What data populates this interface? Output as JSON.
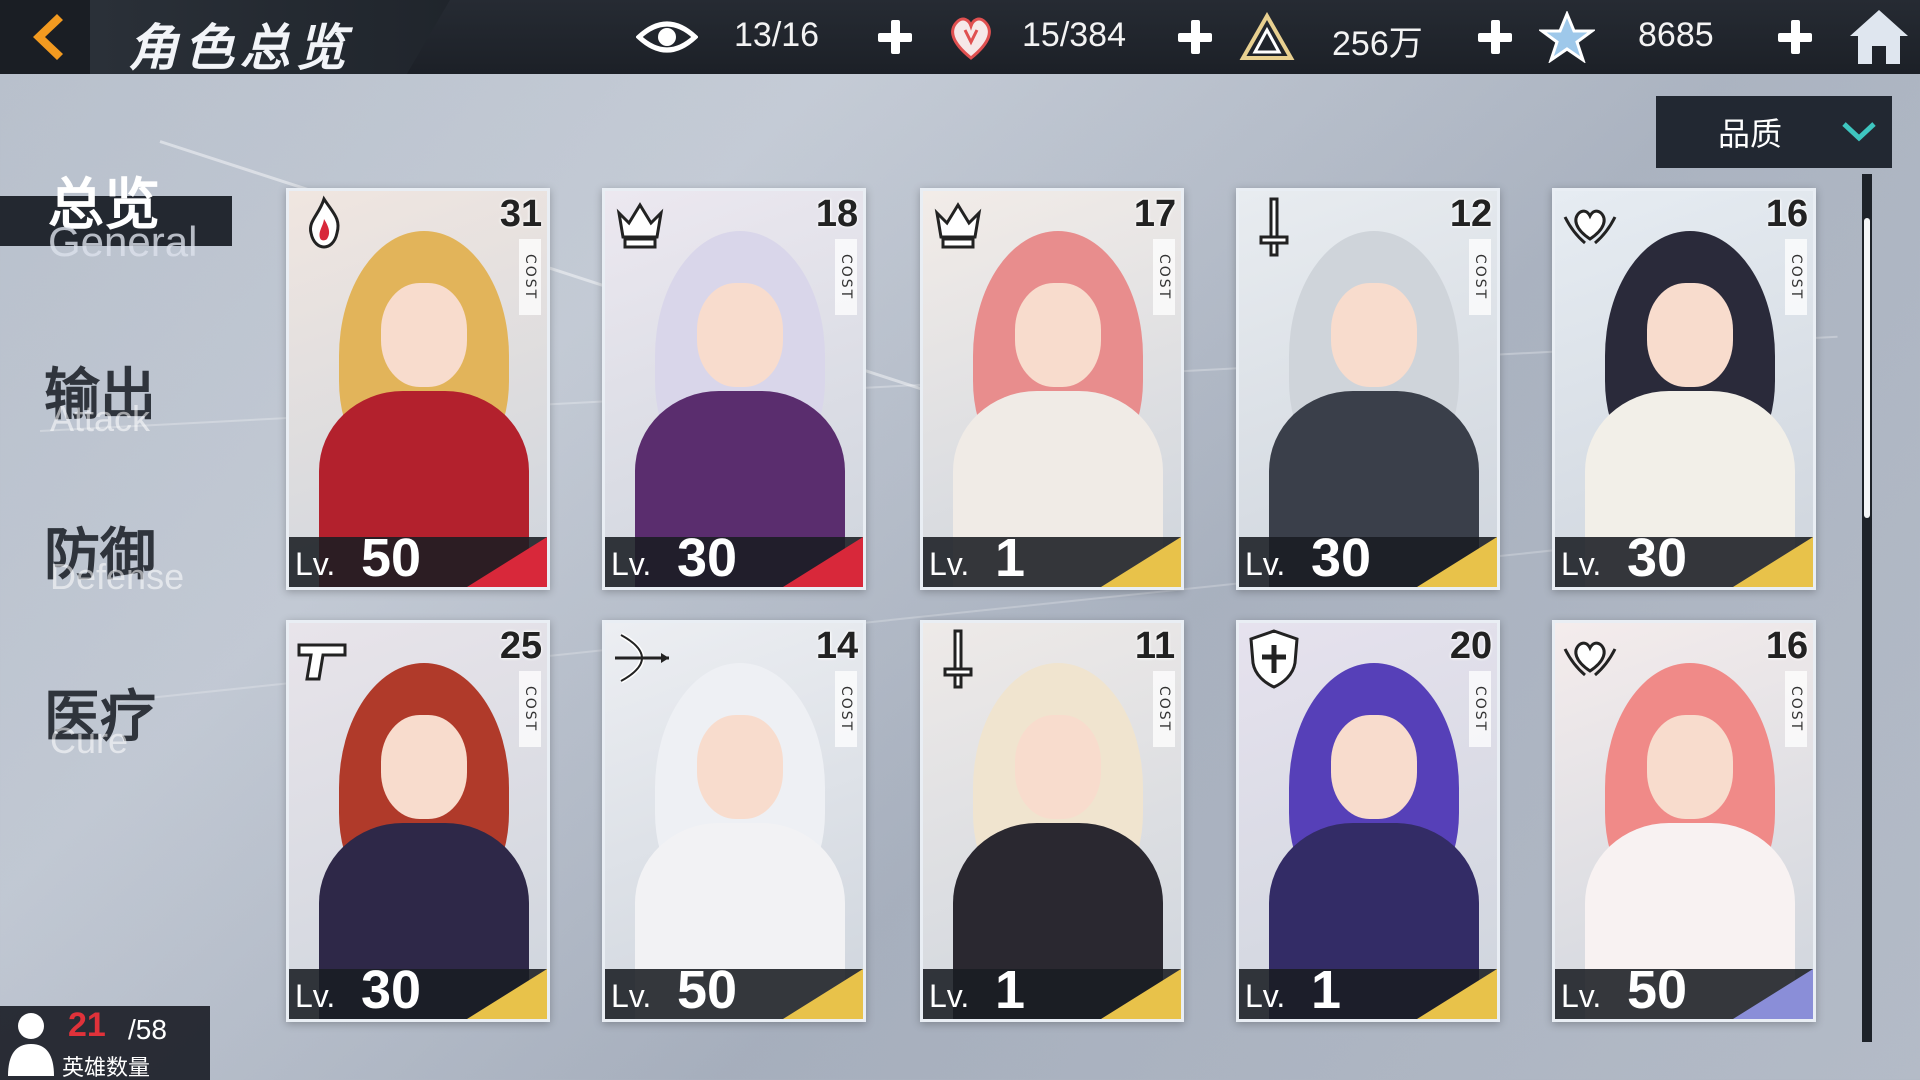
{
  "header": {
    "title": "角色总览",
    "resources": [
      {
        "name": "stamina",
        "icon": "eye-icon",
        "value": "13/16"
      },
      {
        "name": "crystal",
        "icon": "heart-crystal-icon",
        "value": "15/384"
      },
      {
        "name": "gold",
        "icon": "pyramid-icon",
        "value": "256万"
      },
      {
        "name": "star-points",
        "icon": "star-icon",
        "value": "8685"
      }
    ]
  },
  "sort": {
    "label": "品质"
  },
  "nav": {
    "items": [
      {
        "cn": "总览",
        "en": "General",
        "active": true
      },
      {
        "cn": "输出",
        "en": "Attack",
        "active": false
      },
      {
        "cn": "防御",
        "en": "Defense",
        "active": false
      },
      {
        "cn": "医疗",
        "en": "Cure",
        "active": false
      }
    ]
  },
  "cards": [
    {
      "cost": "31",
      "level": "50",
      "class_icon": "fire-icon",
      "rarity_color": "#d8283a"
    },
    {
      "cost": "18",
      "level": "30",
      "class_icon": "crown-emblem-icon",
      "rarity_color": "#d8283a"
    },
    {
      "cost": "17",
      "level": "1",
      "class_icon": "crown-emblem-icon",
      "rarity_color": "#e8c24a"
    },
    {
      "cost": "12",
      "level": "30",
      "class_icon": "sword-icon",
      "rarity_color": "#e8c24a"
    },
    {
      "cost": "16",
      "level": "30",
      "class_icon": "winged-heart-icon",
      "rarity_color": "#e8c24a"
    },
    {
      "cost": "25",
      "level": "30",
      "class_icon": "pistol-icon",
      "rarity_color": "#e8c24a"
    },
    {
      "cost": "14",
      "level": "50",
      "class_icon": "bow-icon",
      "rarity_color": "#e8c24a"
    },
    {
      "cost": "11",
      "level": "1",
      "class_icon": "sword-icon",
      "rarity_color": "#e8c24a"
    },
    {
      "cost": "20",
      "level": "1",
      "class_icon": "shield-icon",
      "rarity_color": "#e8c24a"
    },
    {
      "cost": "16",
      "level": "50",
      "class_icon": "winged-heart-icon",
      "rarity_color": "#8a8ed8"
    }
  ],
  "card_labels": {
    "cost": "COST",
    "level_prefix": "Lv."
  },
  "hero_count": {
    "current": "21",
    "total": "/58",
    "label": "英雄数量"
  }
}
